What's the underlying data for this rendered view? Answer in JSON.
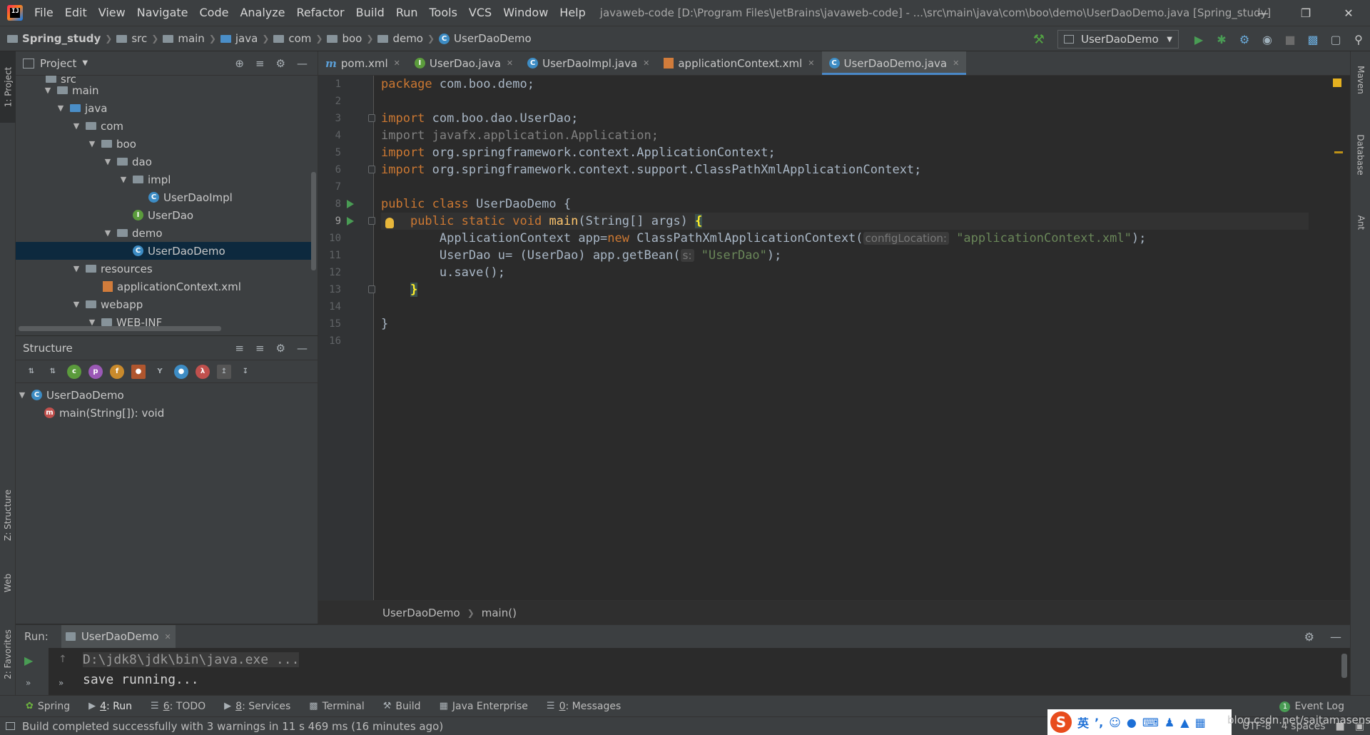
{
  "menu": [
    "File",
    "Edit",
    "View",
    "Navigate",
    "Code",
    "Analyze",
    "Refactor",
    "Build",
    "Run",
    "Tools",
    "VCS",
    "Window",
    "Help"
  ],
  "window_title": "javaweb-code [D:\\Program Files\\JetBrains\\javaweb-code] - ...\\src\\main\\java\\com\\boo\\demo\\UserDaoDemo.java [Spring_study]",
  "breadcrumb": [
    "Spring_study",
    "src",
    "main",
    "java",
    "com",
    "boo",
    "demo",
    "UserDaoDemo"
  ],
  "run_config": "UserDaoDemo",
  "left_strip": {
    "project": "1: Project",
    "structure": "Z: Structure",
    "web": "Web",
    "favorites": "2: Favorites"
  },
  "right_strip": {
    "maven": "Maven",
    "database": "Database",
    "ant": "Ant"
  },
  "project_panel": {
    "title": "Project",
    "tree": [
      {
        "label": "src",
        "indent": 0
      },
      {
        "label": "main",
        "indent": 1
      },
      {
        "label": "java",
        "indent": 2
      },
      {
        "label": "com",
        "indent": 3
      },
      {
        "label": "boo",
        "indent": 4
      },
      {
        "label": "dao",
        "indent": 5
      },
      {
        "label": "impl",
        "indent": 6
      },
      {
        "label": "UserDaoImpl",
        "indent": 7
      },
      {
        "label": "UserDao",
        "indent": 6
      },
      {
        "label": "demo",
        "indent": 5
      },
      {
        "label": "UserDaoDemo",
        "indent": 6
      },
      {
        "label": "resources",
        "indent": 3
      },
      {
        "label": "applicationContext.xml",
        "indent": 4
      },
      {
        "label": "webapp",
        "indent": 3
      },
      {
        "label": "WEB-INF",
        "indent": 4
      }
    ]
  },
  "structure_panel": {
    "title": "Structure",
    "class_name": "UserDaoDemo",
    "method": "main(String[]): void"
  },
  "tabs": [
    "pom.xml",
    "UserDao.java",
    "UserDaoImpl.java",
    "applicationContext.xml",
    "UserDaoDemo.java"
  ],
  "line_numbers": [
    "1",
    "2",
    "3",
    "4",
    "5",
    "6",
    "7",
    "8",
    "9",
    "10",
    "11",
    "12",
    "13",
    "14",
    "15",
    "16"
  ],
  "code": {
    "l1_kw": "package",
    "l1_rest": " com.boo.demo;",
    "l3_kw": "import",
    "l3_rest": " com.boo.dao.UserDao;",
    "l4": "import javafx.application.Application;",
    "l5_kw": "import",
    "l5_rest": " org.springframework.context.ApplicationContext;",
    "l6_kw": "import",
    "l6_rest": " org.springframework.context.support.ClassPathXmlApplicationContext;",
    "l8_kw": "public class",
    "l8_rest": " UserDaoDemo {",
    "l9_kw": "public static void",
    "l9_fn": "main",
    "l9_rest": "(String[] args) ",
    "l9_brace": "{",
    "l10_a": "ApplicationContext app=",
    "l10_kw": "new",
    "l10_b": " ClassPathXmlApplicationContext(",
    "l10_hint": "configLocation:",
    "l10_str": "\"applicationContext.xml\"",
    "l10_c": ");",
    "l11_a": "UserDao u= (UserDao) app.getBean(",
    "l11_hint": "s:",
    "l11_str": "\"UserDao\"",
    "l11_c": ");",
    "l12": "u.save();",
    "l13_brace": "}",
    "l15": "}"
  },
  "editor_breadcrumb": [
    "UserDaoDemo",
    "main()"
  ],
  "run_panel": {
    "label": "Run:",
    "tab": "UserDaoDemo",
    "output": [
      "D:\\jdk8\\jdk\\bin\\java.exe ...",
      "save running..."
    ]
  },
  "bottom_tabs": [
    {
      "key": "",
      "label": "Spring"
    },
    {
      "key": "4",
      "label": ": Run"
    },
    {
      "key": "6",
      "label": ": TODO"
    },
    {
      "key": "8",
      "label": ": Services"
    },
    {
      "key": "",
      "label": "Terminal"
    },
    {
      "key": "",
      "label": "Build"
    },
    {
      "key": "",
      "label": "Java Enterprise"
    },
    {
      "key": "0",
      "label": ": Messages"
    }
  ],
  "event_log": {
    "count": "1",
    "label": "Event Log"
  },
  "status": {
    "message": "Build completed successfully with 3 warnings in 11 s 469 ms (16 minutes ago)",
    "encoding": "UTF-8",
    "indent": "4 spaces"
  },
  "ime": {
    "lang": "英"
  },
  "watermark": "blog.csdn.net/saitamasensei",
  "colors": {
    "keyword": "#cc7832",
    "string": "#6a8759",
    "function": "#ffc66d",
    "accent": "#4a88c7",
    "run_green": "#499c54"
  }
}
